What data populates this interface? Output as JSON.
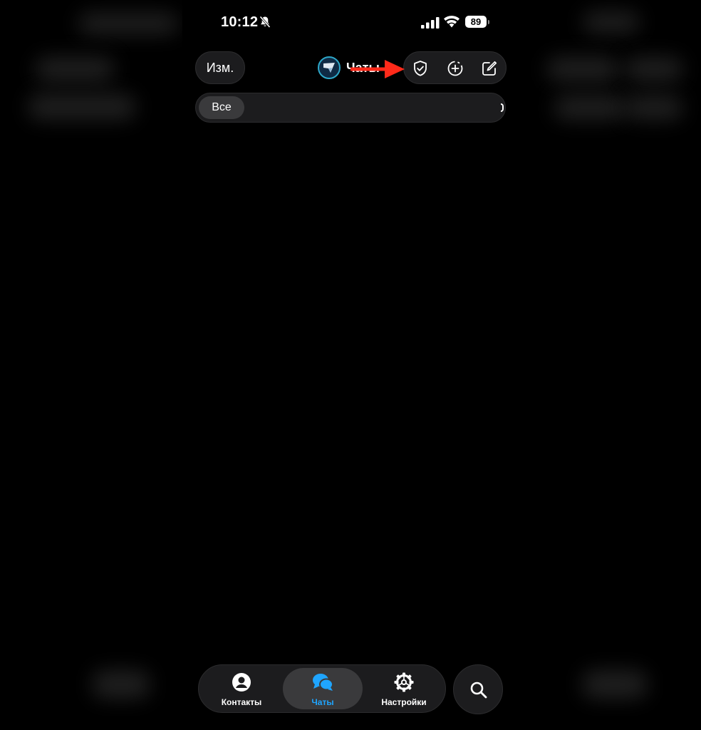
{
  "status_bar": {
    "time": "10:12",
    "battery": "89",
    "icons": [
      "bell-slash-icon",
      "signal-icon",
      "wifi-icon",
      "battery-icon"
    ]
  },
  "header": {
    "edit_label": "Изм.",
    "title": "Чаты",
    "actions": [
      "shield-check-icon",
      "add-story-icon",
      "compose-icon"
    ]
  },
  "filters": [
    {
      "label": "Все",
      "selected": true
    }
  ],
  "tabbar": {
    "items": [
      {
        "label": "Контакты",
        "icon": "person-circle-icon"
      },
      {
        "label": "Чаты",
        "icon": "chat-bubbles-icon",
        "active": true
      },
      {
        "label": "Настройки",
        "icon": "gear-icon"
      }
    ],
    "search_icon": "search-icon"
  },
  "colors": {
    "background": "#000000",
    "surface": "#1c1c1e",
    "selected_surface": "#3a3a3c",
    "accent": "#1fa5ff",
    "annotation_arrow": "#ff2a1a"
  }
}
